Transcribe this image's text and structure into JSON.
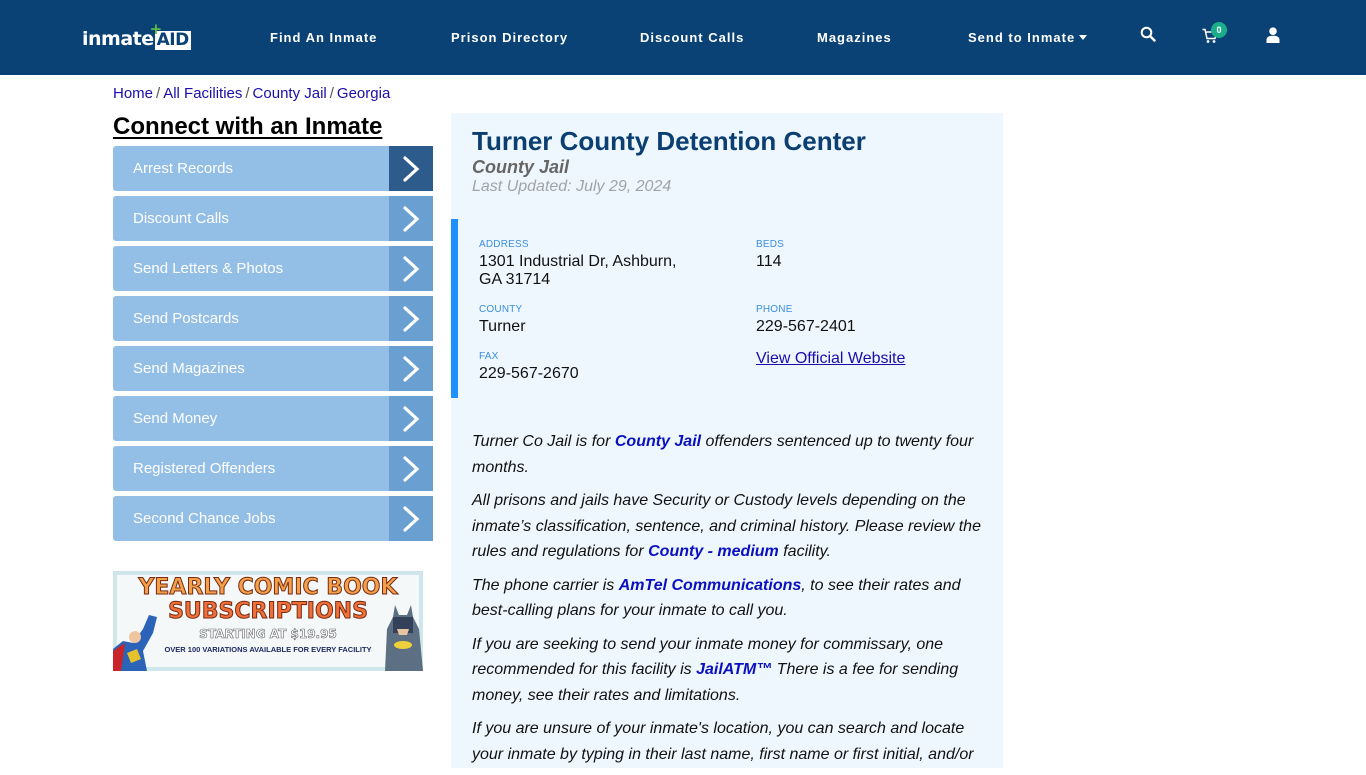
{
  "header": {
    "logo": {
      "part1": "inmate",
      "part2": "AID",
      "plus": "+"
    },
    "nav": [
      {
        "label": "Find An Inmate"
      },
      {
        "label": "Prison Directory"
      },
      {
        "label": "Discount Calls"
      },
      {
        "label": "Magazines"
      },
      {
        "label": "Send to Inmate",
        "has_dropdown": true
      }
    ],
    "icons": {
      "search": "search-icon",
      "cart": "cart-icon",
      "user": "user-icon"
    },
    "cart_count": "0"
  },
  "breadcrumb": [
    {
      "label": "Home"
    },
    {
      "label": "All Facilities"
    },
    {
      "label": "County Jail"
    },
    {
      "label": "Georgia"
    }
  ],
  "breadcrumb_sep": "/",
  "sidebar": {
    "title": "Connect with an Inmate",
    "items": [
      {
        "label": "Arrest Records",
        "active": true
      },
      {
        "label": "Discount Calls"
      },
      {
        "label": "Send Letters & Photos"
      },
      {
        "label": "Send Postcards"
      },
      {
        "label": "Send Magazines"
      },
      {
        "label": "Send Money"
      },
      {
        "label": "Registered Offenders"
      },
      {
        "label": "Second Chance Jobs"
      }
    ],
    "banner": {
      "line1": "YEARLY COMIC BOOK",
      "line2": "SUBSCRIPTIONS",
      "line3": "STARTING AT $19.95",
      "line4": "OVER 100 VARIATIONS AVAILABLE FOR EVERY FACILITY"
    }
  },
  "facility": {
    "name": "Turner County Detention Center",
    "type": "County Jail",
    "last_updated": "Last Updated: July 29, 2024",
    "address_label": "ADDRESS",
    "address_line1": "1301 Industrial Dr, Ashburn,",
    "address_line2": "GA 31714",
    "beds_label": "BEDS",
    "beds": "114",
    "county_label": "COUNTY",
    "county": "Turner",
    "phone_label": "PHONE",
    "phone": "229-567-2401",
    "fax_label": "FAX",
    "fax": "229-567-2670",
    "website_link": "View Official Website"
  },
  "content": {
    "p1": {
      "pre": "Turner Co Jail is for ",
      "link": "County Jail",
      "post": " offenders sentenced up to twenty four months."
    },
    "p2": {
      "pre": "All prisons and jails have Security or Custody levels depending on the inmate’s classification, sentence, and criminal history. Please review the rules and regulations for ",
      "link": "County - medium",
      "post": " facility."
    },
    "p3": {
      "pre": "The phone carrier is ",
      "link": "AmTel Communications",
      "post": ", to see their rates and best-calling plans for your inmate to call you."
    },
    "p4": {
      "pre": "If you are seeking to send your inmate money for commissary, one recommended for this facility is ",
      "link": "JailATM™",
      "post": " There is a fee for sending money, see their rates and limitations."
    },
    "p5": {
      "text": "If you are unsure of your inmate's location, you can search and locate your inmate by typing in their last name, first name or first initial, and/or"
    }
  },
  "colors": {
    "header_bg": "#0a4275",
    "sidebar_item": "#93bfe7",
    "sidebar_arrow": "#6a9fd2",
    "sidebar_arrow_active": "#2d5b8c",
    "card_bg": "#eef7fd",
    "accent_bar": "#1e90ff",
    "title": "#0b3f72",
    "link": "#0a10c0",
    "cart_badge": "#1aae8a"
  }
}
